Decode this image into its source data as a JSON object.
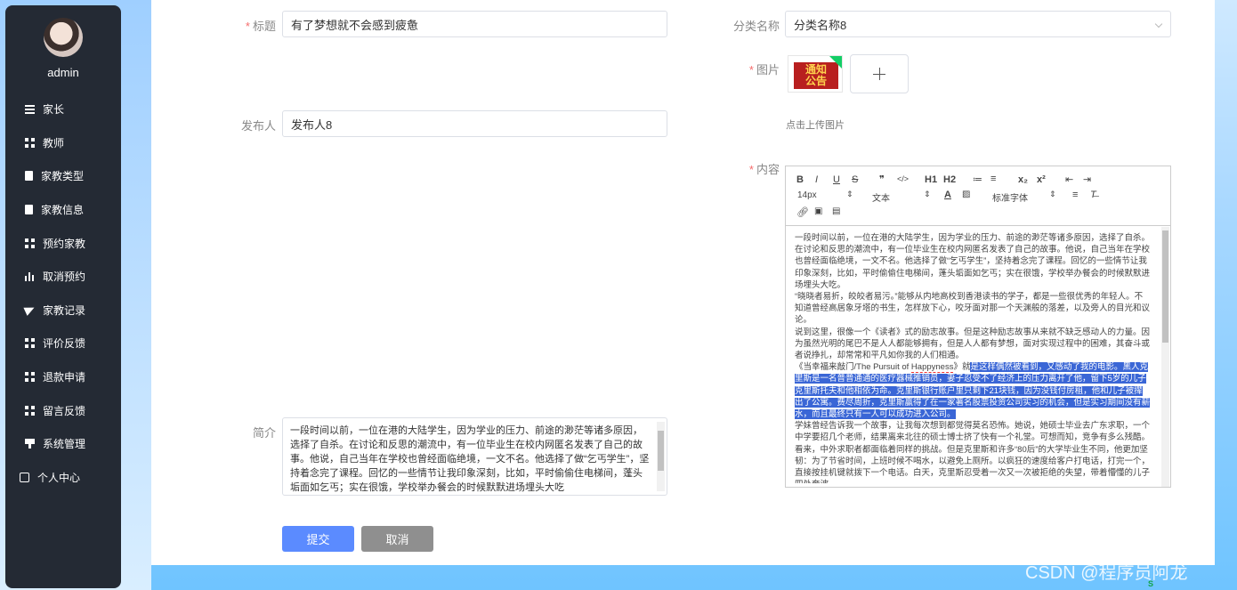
{
  "sidebar": {
    "username": "admin",
    "items": [
      {
        "label": "家长",
        "icon": "list-icon"
      },
      {
        "label": "教师",
        "icon": "grid-icon"
      },
      {
        "label": "家教类型",
        "icon": "clipboard-icon"
      },
      {
        "label": "家教信息",
        "icon": "clipboard-icon"
      },
      {
        "label": "预约家教",
        "icon": "grid-icon"
      },
      {
        "label": "取消预约",
        "icon": "bar-chart-icon"
      },
      {
        "label": "家教记录",
        "icon": "paper-plane-icon"
      },
      {
        "label": "评价反馈",
        "icon": "grid-icon"
      },
      {
        "label": "退款申请",
        "icon": "grid-icon"
      },
      {
        "label": "留言反馈",
        "icon": "grid-icon"
      },
      {
        "label": "系统管理",
        "icon": "monitor-icon"
      },
      {
        "label": "个人中心",
        "icon": "user-card-icon"
      }
    ]
  },
  "form": {
    "title_label": "标题",
    "title_value": "有了梦想就不会感到疲惫",
    "category_label": "分类名称",
    "category_value": "分类名称8",
    "image_label": "图片",
    "image_thumb_text": "通知\n公告",
    "upload_hint": "点击上传图片",
    "publisher_label": "发布人",
    "publisher_value": "发布人8",
    "content_label": "内容",
    "intro_label": "简介",
    "intro_value": "一段时间以前，一位在港的大陆学生，因为学业的压力、前途的渺茫等诸多原因，选择了自杀。在讨论和反思的潮流中，有一位毕业生在校内网匿名发表了自己的故事。他说，自己当年在学校也曾经面临绝境，一文不名。他选择了做“乞丐学生”，坚持着念完了课程。回忆的一些情节让我印象深刻，比如，平时偷偷住电梯间，蓬头垢面如乞丐；实在很饿，学校举办餐会的时候默默进场埋头大吃",
    "submit_label": "提交",
    "cancel_label": "取消"
  },
  "editor": {
    "toolbar_row1": [
      "B",
      "I",
      "U",
      "S",
      "❞",
      "</>",
      "H1",
      "H2",
      "≔",
      "≡",
      "x₂",
      "x²",
      "⇤",
      "⇥"
    ],
    "font_size": "14px",
    "text_type": "文本",
    "font_family": "标准字体",
    "paragraphs": [
      "一段时间以前，一位在港的大陆学生，因为学业的压力、前途的渺茫等诸多原因，选择了自杀。在讨论和反思的潮流中，有一位毕业生在校内网匿名发表了自己的故事。他说，自己当年在学校也曾经面临绝境，一文不名。他选择了做“乞丐学生”，坚持着念完了课程。回忆的一些情节让我印象深刻，比如，平时偷偷住电梯间，蓬头垢面如乞丐；实在很饿，学校举办餐会的时候默默进场埋头大吃。",
      "“晓晓者易折，皎皎者易污。”能够从内地高校到香港读书的学子，都是一些很优秀的年轻人。不知道曾经高居象牙塔的书生，怎样放下心，咬牙面对那一个天渊般的落差，以及旁人的目光和议论。",
      "说到这里，很像一个《读者》式的励志故事。但是这种励志故事从来就不缺乏感动人的力量。因为虽然光明的尾巴不是人人都能够拥有，但是人人都有梦想，面对实现过程中的困难，其奋斗或者说挣扎，却常常和平凡如你我的人们相通。"
    ],
    "movie_prefix": "《当幸福来敲门/The Pursuit of ",
    "movie_word": "Happyness",
    "movie_suffix": "》就",
    "highlight_text": "是这样偶然被看到，又感动了我的电影。黑人克里斯是一名普普通通的医疗器械推销员，妻子忍受不了经济上的压力离开了他，留下5岁的儿子克里斯托夫和他相依为命。克里斯银行账户里只剩下21块钱，因为没钱付房租，他和儿子被撵出了公寓。费尽周折，克里斯赢得了在一家著名股票投资公司实习的机会，但是实习期间没有薪水，而且最终只有一人可以成功进入公司。",
    "after_text": "学妹曾经告诉我一个故事，让我每次想到都觉得莫名恐怖。她说，她硕士毕业去广东求职，一个中学要招几个老师，结果离来北往的硕士博士挤了快有一个礼堂。可想而知，竞争有多么残酷。看来，中外求职者都面临着同样的挑战。但是克里斯和许多“80后”的大学毕业生不同，他更加坚韧：为了节省时间，上班时候不喝水，以避免上厕所。以疯狂的速度给客户打电话，打完一个，直接按挂机键就拨下一个电话。白天，克里斯忍受着一次又一次被拒绝的失望，带着懵懂的儿子四处奔波"
  },
  "watermark": "CSDN @程序员阿龙",
  "colors": {
    "sidebar_bg": "#242a34",
    "submit": "#5b8bff",
    "cancel": "#8f8f8f",
    "required": "#f56c6c",
    "highlight": "#3a66d6"
  }
}
